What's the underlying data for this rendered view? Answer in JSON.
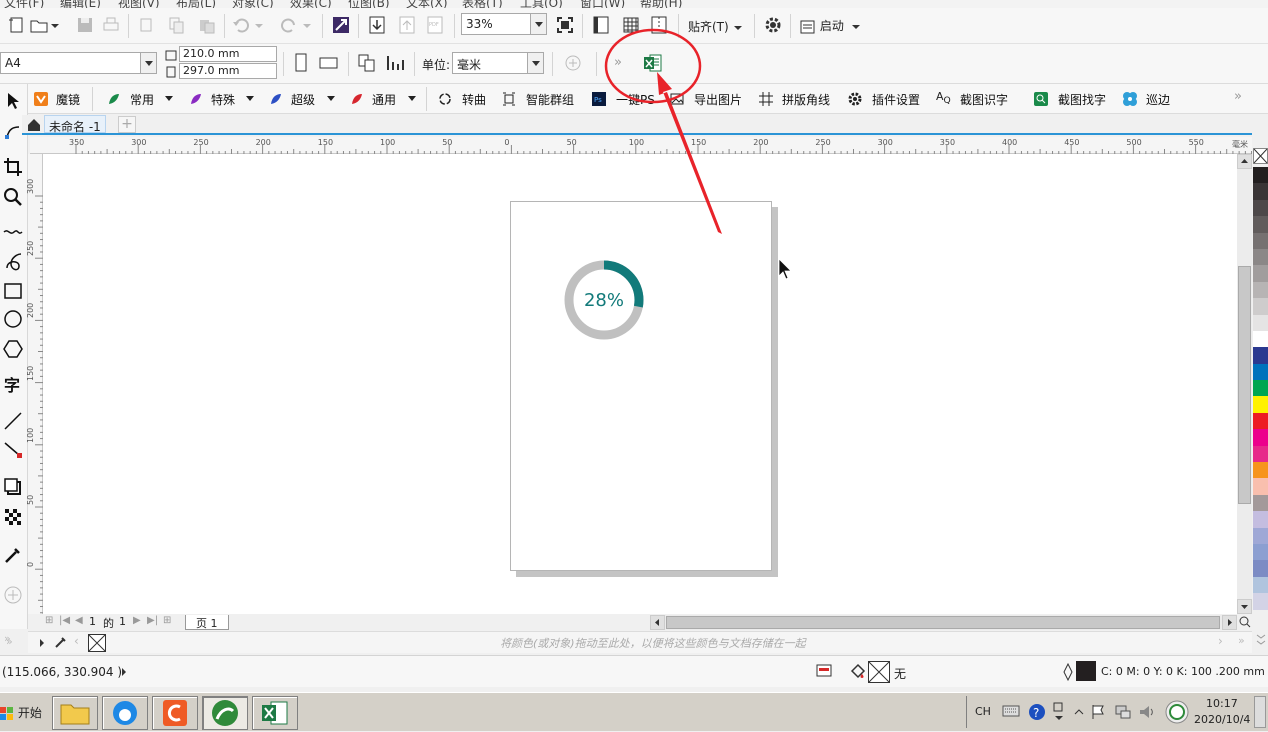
{
  "menubar": {
    "items": [
      "文件(F)",
      "编辑(E)",
      "视图(V)",
      "布局(L)",
      "对象(C)",
      "效果(C)",
      "位图(B)",
      "文本(X)",
      "表格(T)",
      "工具(O)",
      "窗口(W)",
      "帮助(H)"
    ]
  },
  "toolbar": {
    "zoom_value": "33%",
    "snap_label": "贴齐(T)",
    "launch_label": "启动"
  },
  "propbar": {
    "page_size": "A4",
    "width": "210.0 mm",
    "height": "297.0 mm",
    "unit_label": "单位:",
    "unit_value": "毫米"
  },
  "plugins": {
    "items": [
      "魔镜",
      "常用",
      "特殊",
      "超级",
      "通用",
      "转曲",
      "智能群组",
      "一键PS",
      "导出图片",
      "拼版角线",
      "插件设置",
      "截图识字",
      "截图找字",
      "巡边"
    ]
  },
  "document": {
    "tab_title": "未命名 -1"
  },
  "ruler": {
    "h_ticks": [
      "350",
      "300",
      "250",
      "200",
      "150",
      "100",
      "50",
      "0",
      "50",
      "100",
      "150",
      "200",
      "250",
      "300",
      "350",
      "400",
      "450",
      "500",
      "550"
    ],
    "unit": "毫米",
    "v_ticks": [
      "300",
      "250",
      "200",
      "150",
      "100",
      "50",
      "0"
    ]
  },
  "canvas": {
    "progress": {
      "percent_label": "28%",
      "value": 0.28,
      "track_color": "#c0c0c0",
      "fill_color": "#127a7a"
    }
  },
  "pagenav": {
    "current": "1",
    "of_label": "的",
    "total": "1",
    "page_tab": "页 1"
  },
  "colorbar": {
    "hint": "将颜色(或对象)拖动至此处，以便将这些颜色与文档存储在一起"
  },
  "status": {
    "coords": "(115.066, 330.904 )",
    "fill_label": "无",
    "outline_label": "C: 0 M: 0 Y: 0 K: 100  .200 mm"
  },
  "palette": [
    "#231f20",
    "#3a3536",
    "#4d4849",
    "#615c5c",
    "#767171",
    "#8b8787",
    "#a19d9d",
    "#b7b4b4",
    "#cecccc",
    "#e5e4e4",
    "#ffffff",
    "#2b3990",
    "#0072bc",
    "#00a651",
    "#fff200",
    "#ed1c24",
    "#ec008c",
    "#e7298a",
    "#f7941d",
    "#f9bfae",
    "#a3999a",
    "#c4bde0",
    "#9fa8d6",
    "#8c9fd1",
    "#7c8bc4",
    "#b0c4de",
    "#d3d3e6"
  ],
  "taskbar": {
    "start_label": "开始",
    "lang": "CH",
    "time": "10:17",
    "date": "2020/10/4"
  },
  "annotation": {
    "color": "#e8232a"
  }
}
